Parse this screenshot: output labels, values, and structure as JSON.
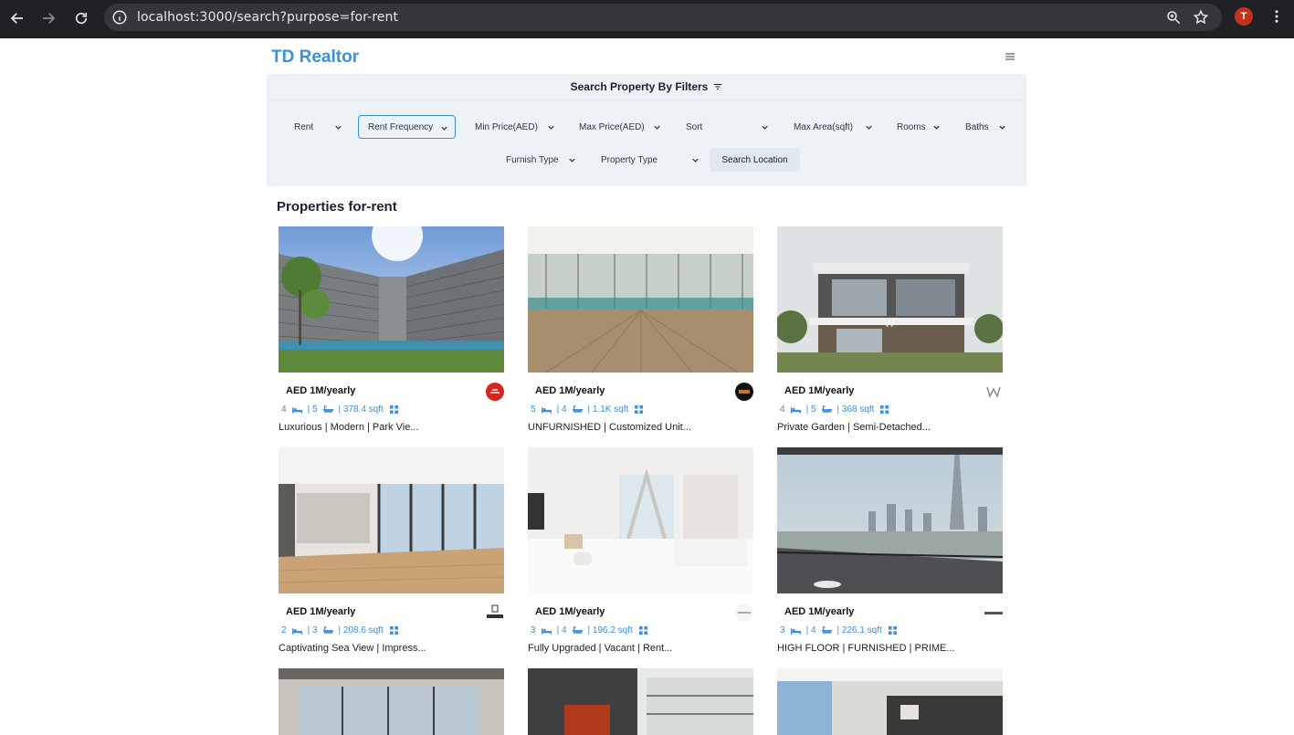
{
  "browser": {
    "url": "localhost:3000/search?purpose=for-rent",
    "avatar_letter": "T"
  },
  "app": {
    "brand": "TD Realtor"
  },
  "filters": {
    "header": "Search Property By Filters",
    "row1": [
      "Rent",
      "Rent Frequency",
      "Min Price(AED)",
      "Max Price(AED)",
      "Sort",
      "Max Area(sqft)",
      "Rooms",
      "Baths"
    ],
    "row2": [
      "Furnish Type",
      "Property Type"
    ],
    "search_location": "Search Location"
  },
  "results": {
    "heading": "Properties for-rent",
    "cards": [
      {
        "price": "AED 1M/yearly",
        "rooms": "4",
        "baths": "| 5",
        "area": "| 378.4 sqft",
        "title": "Luxurious | Modern | Park Vie...",
        "agency_icon": "red-logo"
      },
      {
        "price": "AED 1M/yearly",
        "rooms": "5",
        "baths": "| 4",
        "area": "| 1.1K sqft",
        "title": "UNFURNISHED | Customized Unit...",
        "agency_icon": "black-logo"
      },
      {
        "price": "AED 1M/yearly",
        "rooms": "4",
        "baths": "| 5",
        "area": "| 368 sqft",
        "title": "Private Garden | Semi-Detached...",
        "agency_icon": "w-logo"
      },
      {
        "price": "AED 1M/yearly",
        "rooms": "2",
        "baths": "| 3",
        "area": "| 208.6 sqft",
        "title": "Captivating Sea View | Impress...",
        "agency_icon": "driven-logo"
      },
      {
        "price": "AED 1M/yearly",
        "rooms": "3",
        "baths": "| 4",
        "area": "| 196.2 sqft",
        "title": "Fully Upgraded | Vacant | Rent...",
        "agency_icon": "novvi-logo"
      },
      {
        "price": "AED 1M/yearly",
        "rooms": "3",
        "baths": "| 4",
        "area": "| 226.1 sqft",
        "title": "HIGH FLOOR | FURNISHED | PRIME...",
        "agency_icon": "esg-logo"
      }
    ]
  }
}
